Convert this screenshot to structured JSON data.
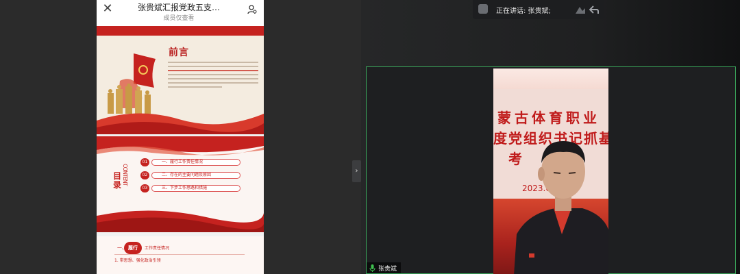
{
  "document": {
    "title": "张贵斌汇报党政五支…",
    "subtitle": "成员仅查看"
  },
  "slides": {
    "preface_title": "前言",
    "contents_vertical": "CONTENT",
    "contents_title": "目录",
    "toc": [
      {
        "num": "01",
        "label": "一、履行工作责任情况"
      },
      {
        "num": "02",
        "label": "二、存在的主要问题及原因"
      },
      {
        "num": "03",
        "label": "三、下步工作思路和措施"
      }
    ],
    "section3": {
      "prefix": "一、",
      "badge": "履行",
      "rest": "工作责任情况",
      "sub": "1. 带思想、强化政治引领"
    }
  },
  "meeting": {
    "speaking_label": "正在讲话: 张贵斌;",
    "participant_name": "张贵斌",
    "video_text": {
      "line1": "蒙古体育职业",
      "line2": "度党组织书记抓基",
      "line3": "考 核",
      "date": "2023.01"
    }
  },
  "icons": {
    "close": "close-icon",
    "viewer": "person-settings-icon",
    "collapse": "chevron-right-icon",
    "mic": "microphone-icon",
    "share": "share-icon",
    "back": "back-arrow-icon"
  },
  "colors": {
    "active_speaker_border": "#3aa55a",
    "party_red": "#c5221f",
    "mic_green": "#3fbf4f"
  }
}
